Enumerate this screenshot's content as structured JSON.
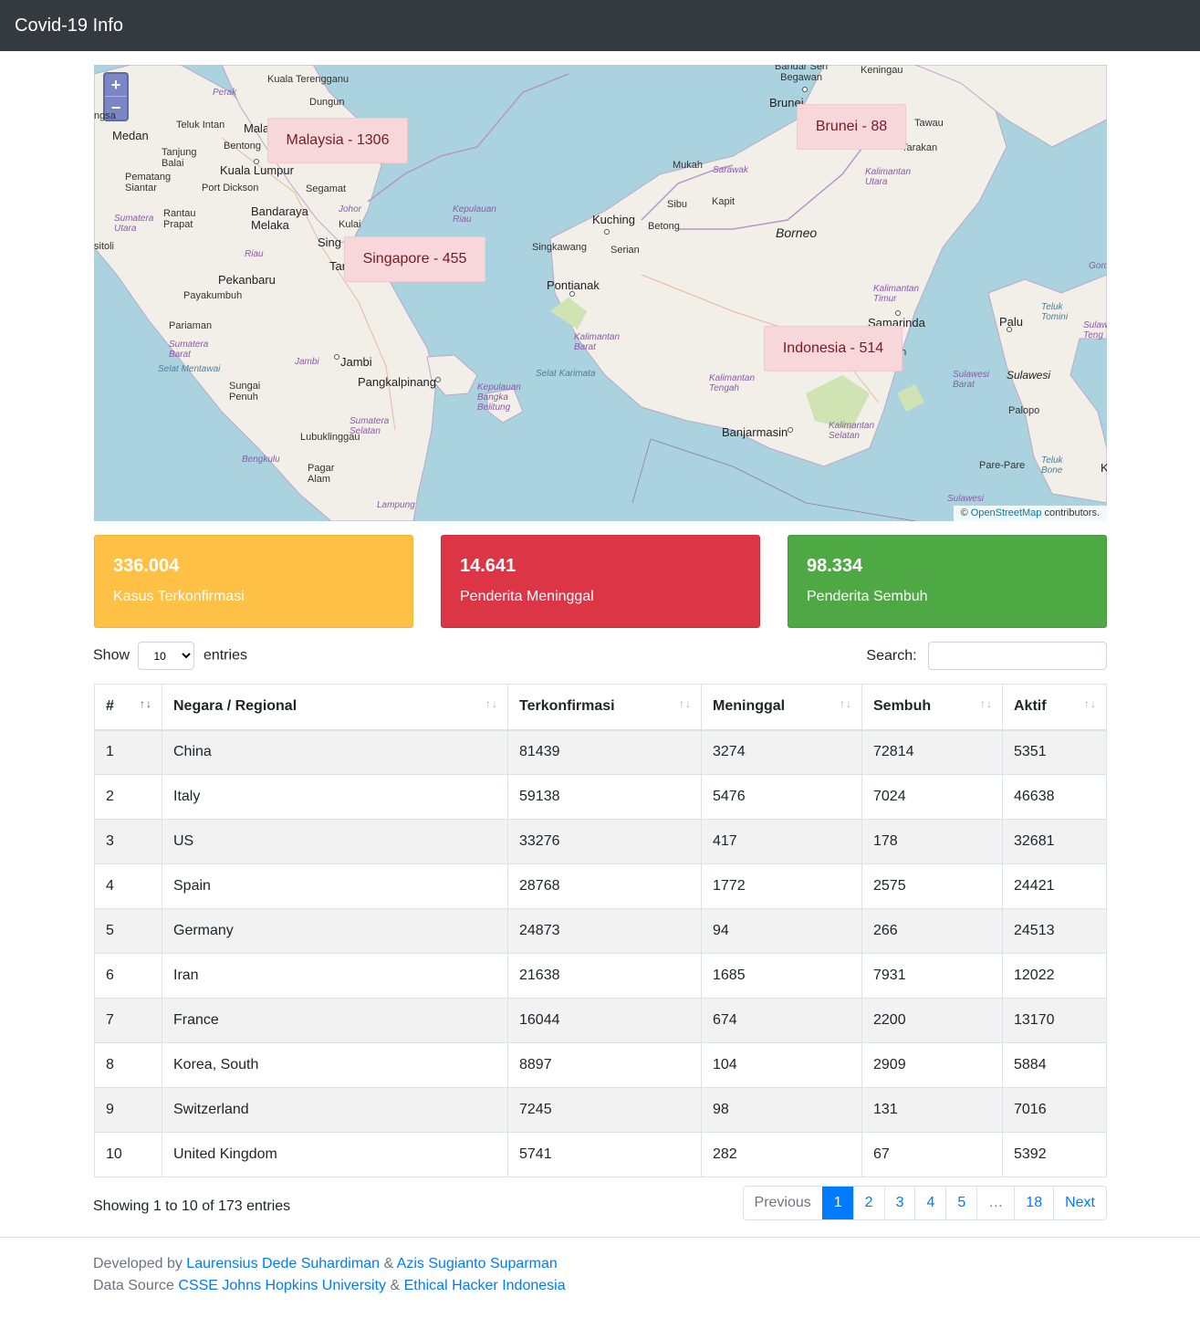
{
  "navbar": {
    "brand": "Covid-19 Info"
  },
  "map": {
    "zoom_in": "+",
    "zoom_out": "−",
    "popups": [
      {
        "text": "Malaysia - 1306"
      },
      {
        "text": "Singapore - 455"
      },
      {
        "text": "Brunei - 88"
      },
      {
        "text": "Indonesia - 514"
      }
    ],
    "labels": {
      "kuala_terengganu": "Kuala Terengganu",
      "dungun": "Dungun",
      "perak": "Perak",
      "teluk_intan": "Teluk Intan",
      "medan": "Medan",
      "bentong": "Bentong",
      "kuala_lumpur": "Kuala Lumpur",
      "tanjung_balai": "Tanjung\nBalai",
      "pematang_siantar": "Pematang\nSiantar",
      "port_dickson": "Port Dickson",
      "segamat": "Segamat",
      "rantau_prapat": "Rantau\nPrapat",
      "bandaraya_melaka": "Bandaraya\nMelaka",
      "johor": "Johor",
      "kulai": "Kulai",
      "sumatera_utara": "Sumatera\nUtara",
      "riau": "Riau",
      "pekanbaru": "Pekanbaru",
      "payakumbuh": "Payakumbuh",
      "pariaman": "Pariaman",
      "sumatera_barat": "Sumatera\nBarat",
      "selat_mentawai": "Selat Mentawai",
      "jambi_prov": "Jambi",
      "jambi": "Jambi",
      "sungai_penuh": "Sungai\nPenuh",
      "pangkalpinang": "Pangkalpinang",
      "kep_bangka": "Kepulauan\nBangka\nBelitung",
      "lubuklinggau": "Lubuklinggau",
      "sumatera_selatan": "Sumatera\nSelatan",
      "bengkulu": "Bengkulu",
      "pagar_alam": "Pagar\nAlam",
      "lampung": "Lampung",
      "kep_riau": "Kepulauan\nRiau",
      "kuching": "Kuching",
      "serian": "Serian",
      "singkawang": "Singkawang",
      "pontianak": "Pontianak",
      "kalbar": "Kalimantan\nBarat",
      "selat_karimata": "Selat Karimata",
      "mukah": "Mukah",
      "sarawak": "Sarawak",
      "sibu": "Sibu",
      "kapit": "Kapit",
      "betong": "Betong",
      "borneo": "Borneo",
      "bandar_seri_begawan": "Bandar Seri\nBegawan",
      "keningau": "Keningau",
      "brunei_label": "Brunei",
      "tawau": "Tawau",
      "tarakan": "Tarakan",
      "kalut": "Kalimantan\nUtara",
      "kaltim": "Kalimantan\nTimur",
      "samarinda": "Samarinda",
      "kalteng": "Kalimantan\nTengah",
      "banjarmasin": "Banjarmasin",
      "kalsel": "Kalimantan\nSelatan",
      "palu": "Palu",
      "teluk_tomini": "Teluk\nTomini",
      "sulawesi": "Sulawesi",
      "sulbar": "Sulawesi\nBarat",
      "palopo": "Palopo",
      "pare_pare": "Pare-Pare",
      "teluk_bone": "Teluk\nBone",
      "sulawesi_bottom": "Sulawesi",
      "gorontalo": "Goro",
      "sulteng": "Sulaw\nTeng",
      "sitoli": "sitoli",
      "tan": "Tan",
      "sing": "Sing",
      "mala": "Mala",
      "an": "an",
      "k": "K",
      "unga": "ngsa"
    },
    "attribution": {
      "prefix": "©",
      "link": "OpenStreetMap",
      "suffix": "contributors."
    }
  },
  "cards": [
    {
      "value": "336.004",
      "label": "Kasus Terkonfirmasi",
      "color": "#ffc145"
    },
    {
      "value": "14.641",
      "label": "Penderita Meninggal",
      "color": "#dc3545"
    },
    {
      "value": "98.334",
      "label": "Penderita Sembuh",
      "color": "#4ea944"
    }
  ],
  "controls": {
    "show": "Show",
    "entries_value": "10",
    "entries": "entries",
    "search_label": "Search:"
  },
  "table": {
    "headers": [
      "#",
      "Negara / Regional",
      "Terkonfirmasi",
      "Meninggal",
      "Sembuh",
      "Aktif"
    ],
    "rows": [
      [
        "1",
        "China",
        "81439",
        "3274",
        "72814",
        "5351"
      ],
      [
        "2",
        "Italy",
        "59138",
        "5476",
        "7024",
        "46638"
      ],
      [
        "3",
        "US",
        "33276",
        "417",
        "178",
        "32681"
      ],
      [
        "4",
        "Spain",
        "28768",
        "1772",
        "2575",
        "24421"
      ],
      [
        "5",
        "Germany",
        "24873",
        "94",
        "266",
        "24513"
      ],
      [
        "6",
        "Iran",
        "21638",
        "1685",
        "7931",
        "12022"
      ],
      [
        "7",
        "France",
        "16044",
        "674",
        "2200",
        "13170"
      ],
      [
        "8",
        "Korea, South",
        "8897",
        "104",
        "2909",
        "5884"
      ],
      [
        "9",
        "Switzerland",
        "7245",
        "98",
        "131",
        "7016"
      ],
      [
        "10",
        "United Kingdom",
        "5741",
        "282",
        "67",
        "5392"
      ]
    ]
  },
  "pagination": {
    "info": "Showing 1 to 10 of 173 entries",
    "previous": "Previous",
    "pages": [
      "1",
      "2",
      "3",
      "4",
      "5",
      "…",
      "18"
    ],
    "next": "Next"
  },
  "footer": {
    "developed_by": "Developed by",
    "dev1": "Laurensius Dede Suhardiman",
    "amp": "&",
    "dev2": "Azis Sugianto Suparman",
    "data_source": "Data Source",
    "src1": "CSSE Johns Hopkins University",
    "src2": "Ethical Hacker Indonesia"
  }
}
